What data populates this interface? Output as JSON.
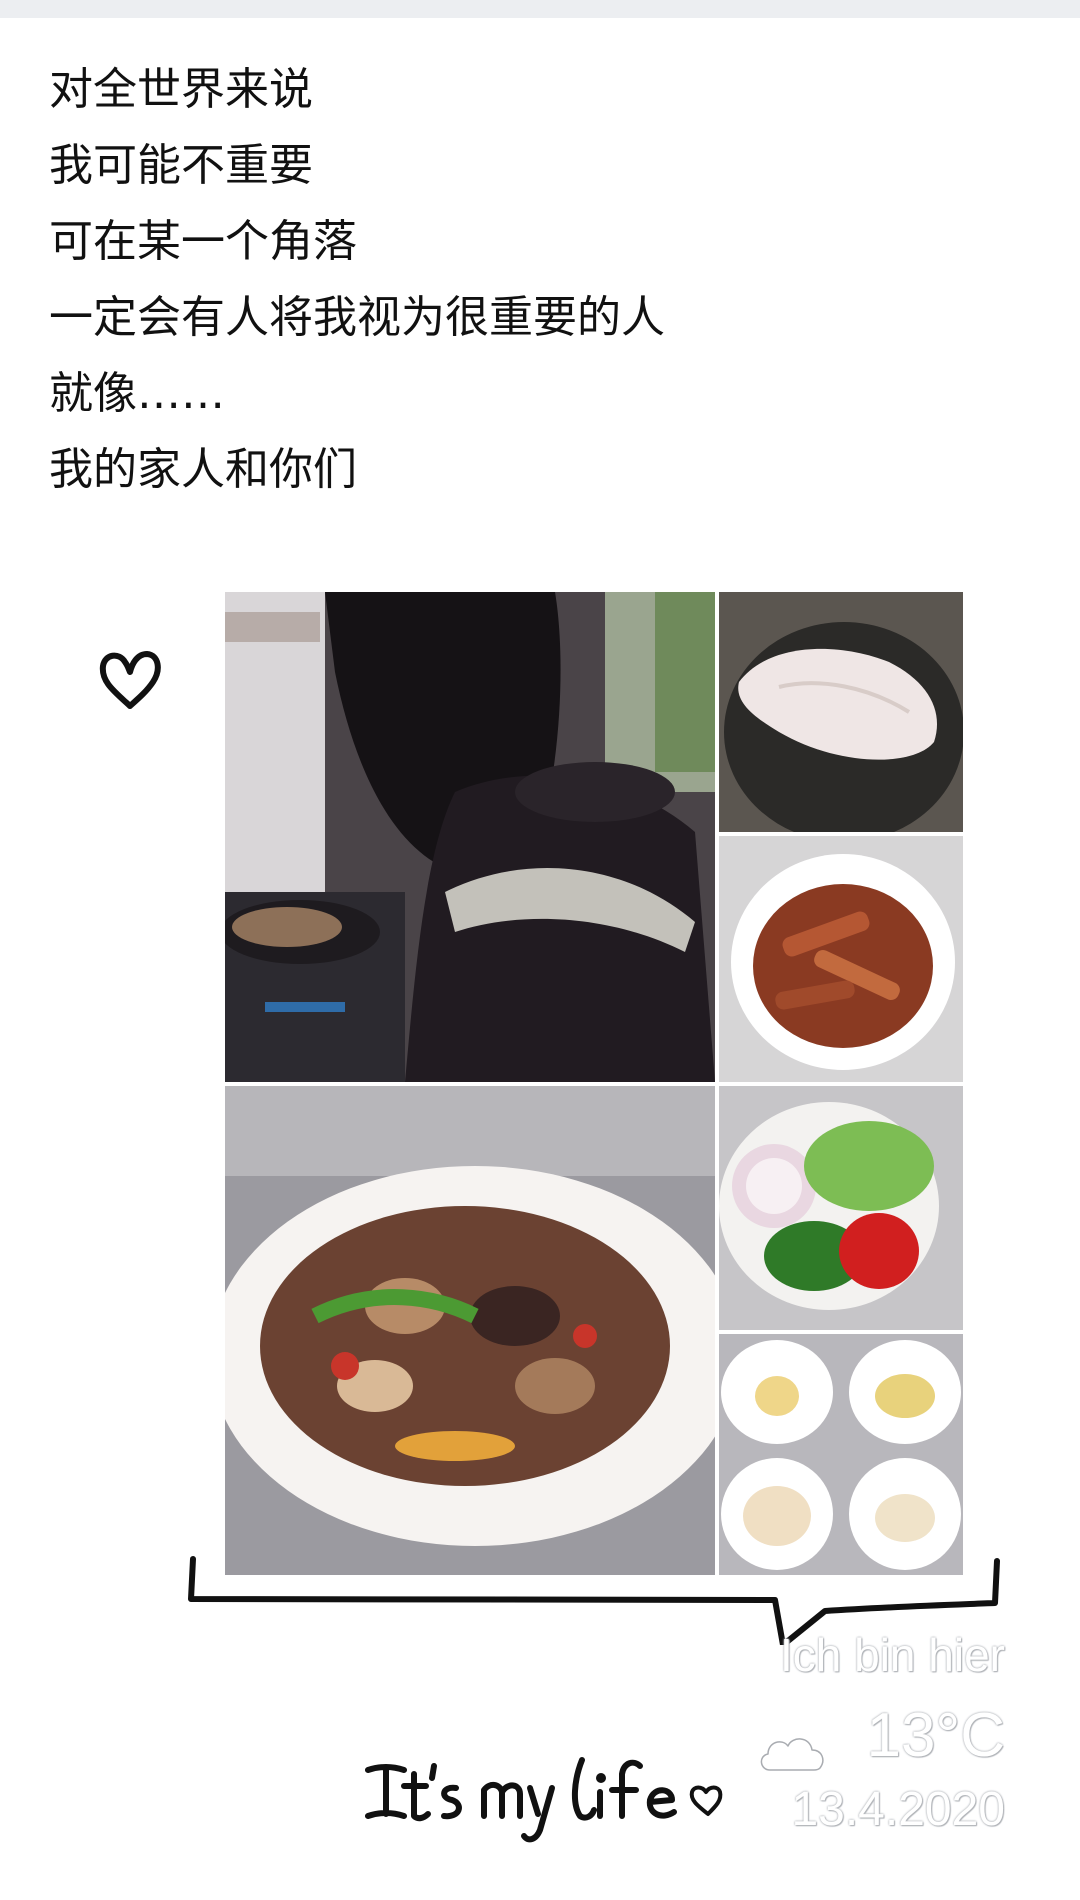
{
  "post": {
    "lines": [
      "对全世界来说",
      "我可能不重要",
      "可在某一个角落",
      "一定会有人将我视为很重要的人",
      "就像……",
      "我的家人和你们"
    ]
  },
  "stamp": {
    "location_text": "Ich bin hier",
    "weather_icon": "cloud-icon",
    "temperature": "13°C",
    "date": "13.4.2020"
  },
  "caption": {
    "handwritten": "It's my life"
  },
  "icons": [
    "heart-icon",
    "cloud-icon"
  ],
  "colors": {
    "background": "#ffffff",
    "text": "#111111",
    "top_bar": "#eceef1"
  }
}
